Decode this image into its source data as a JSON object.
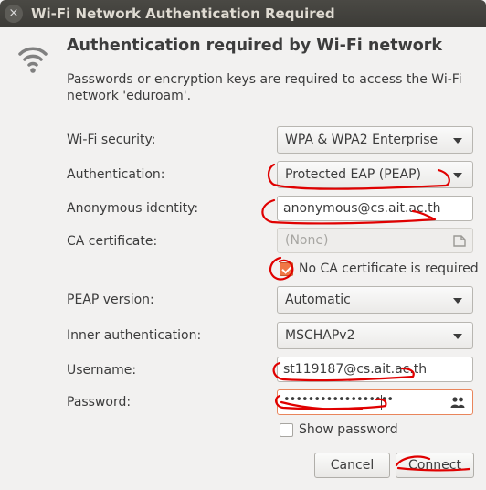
{
  "window": {
    "title": "Wi-Fi Network Authentication Required",
    "close_glyph": "×"
  },
  "heading": "Authentication required by Wi-Fi network",
  "description": "Passwords or encryption keys are required to access the Wi-Fi network 'eduroam'.",
  "fields": {
    "wifi_security": {
      "label": "Wi-Fi security:",
      "value": "WPA & WPA2 Enterprise"
    },
    "authentication": {
      "label": "Authentication:",
      "value": "Protected EAP (PEAP)"
    },
    "anonymous_identity": {
      "label": "Anonymous identity:",
      "value": "anonymous@cs.ait.ac.th"
    },
    "ca_certificate": {
      "label": "CA certificate:",
      "value": "(None)"
    },
    "no_ca_required": {
      "label": "No CA certificate is required",
      "checked": true
    },
    "peap_version": {
      "label": "PEAP version:",
      "value": "Automatic"
    },
    "inner_authentication": {
      "label": "Inner authentication:",
      "value": "MSCHAPv2"
    },
    "username": {
      "label": "Username:",
      "value": "st119187@cs.ait.ac.th"
    },
    "password": {
      "label": "Password:",
      "masked_value": "••••••••••••••••••"
    },
    "show_password": {
      "label": "Show password",
      "checked": false
    }
  },
  "buttons": {
    "cancel": "Cancel",
    "connect": "Connect"
  },
  "icons": [
    "wifi-icon",
    "certificate-file-icon",
    "users-icon",
    "close-icon",
    "chevron-down-icon"
  ],
  "colors": {
    "titlebar": "#3c3b37",
    "accent": "#f07746",
    "annotation_red": "#e00000"
  }
}
